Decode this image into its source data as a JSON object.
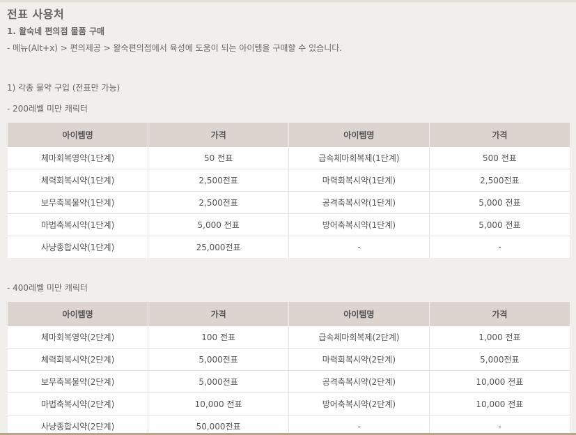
{
  "page": {
    "title": "전표 사용처",
    "subtitle": "1. 왈숙네 편의점 물품 구매",
    "description": "- 메뉴(Alt+x) > 편의제공 > 왈숙편의점에서 육성에 도움이 되는 아이템을 구매할 수 있습니다.",
    "section_title": "1) 각종 물약 구입 (전표만 가능)"
  },
  "headers": [
    "아이템명",
    "가격",
    "아이템명",
    "가격"
  ],
  "group1": {
    "title": "- 200레벨 미만 캐릭터",
    "rows": [
      [
        "체마회복영약(1단계)",
        "50 전표",
        "급속체마회복제(1단계)",
        "500 전표"
      ],
      [
        "체력회복시약(1단계)",
        "2,500전표",
        "마력회복시약(1단계)",
        "2,500전표"
      ],
      [
        "보무축복물약(1단계)",
        "2,500전표",
        "공격축복시약(1단계)",
        "5,000 전표"
      ],
      [
        "마법축복시약(1단계)",
        "5,000 전표",
        "방어축복시약(1단계)",
        "5,000 전표"
      ],
      [
        "사냥종합시약(1단계)",
        "25,000전표",
        "-",
        "-"
      ]
    ]
  },
  "group2": {
    "title": "- 400레벨 미만 캐릭터",
    "rows": [
      [
        "체마회복영약(2단계)",
        "100 전표",
        "급속체마회복제(2단계)",
        "1,000 전표"
      ],
      [
        "체력회복시약(2단계)",
        "5,000전표",
        "마력회복시약(2단계)",
        "5,000전표"
      ],
      [
        "보무축복물약(2단계)",
        "5,000전표",
        "공격축복시약(2단계)",
        "10,000 전표"
      ],
      [
        "마법축복시약(2단계)",
        "10,000 전표",
        "방어축복시약(2단계)",
        "10,000 전표"
      ],
      [
        "사냥종합시약(2단계)",
        "50,000전표",
        "-",
        "-"
      ]
    ]
  }
}
